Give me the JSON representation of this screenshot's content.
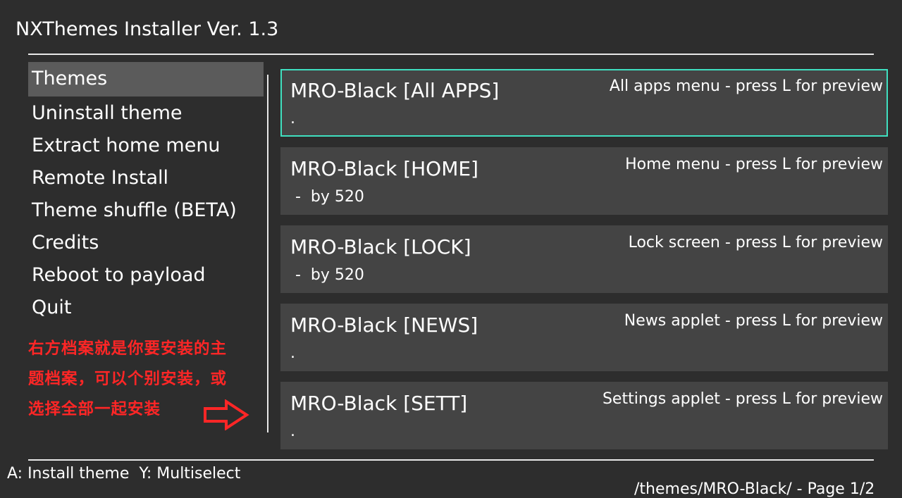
{
  "app": {
    "title": "NXThemes Installer Ver. 1.3"
  },
  "menu": {
    "items": [
      {
        "label": "Themes",
        "selected": true
      },
      {
        "label": "Uninstall theme"
      },
      {
        "label": "Extract home menu"
      },
      {
        "label": "Remote Install"
      },
      {
        "label": "Theme shuffle (BETA)"
      },
      {
        "label": "Credits"
      },
      {
        "label": "Reboot to payload"
      },
      {
        "label": "Quit"
      }
    ]
  },
  "annotation": {
    "lines": [
      "右方档案就是你要安装的主",
      "题档案，可以个别安装，或",
      "选择全部一起安装"
    ],
    "color": "#ff2626"
  },
  "themes": [
    {
      "name": "MRO-Black [All APPS]",
      "description": "All apps menu - press L for preview",
      "author": ".",
      "selected": true
    },
    {
      "name": "MRO-Black [HOME]",
      "description": "Home menu - press L for preview",
      "author": " -  by 520"
    },
    {
      "name": "MRO-Black [LOCK]",
      "description": "Lock screen - press L for preview",
      "author": " -  by 520"
    },
    {
      "name": "MRO-Black [NEWS]",
      "description": "News applet - press L for preview",
      "author": "."
    },
    {
      "name": "MRO-Black [SETT]",
      "description": "Settings applet - press L for preview",
      "author": "."
    }
  ],
  "footer": {
    "hint": "A: Install theme  Y: Multiselect",
    "path": "/themes/MRO-Black/ - Page 1/2"
  },
  "colors": {
    "background": "#2d2d2d",
    "row": "#444444",
    "selection_border": "#3fe0c0",
    "menu_selected": "#5b5b5b"
  }
}
